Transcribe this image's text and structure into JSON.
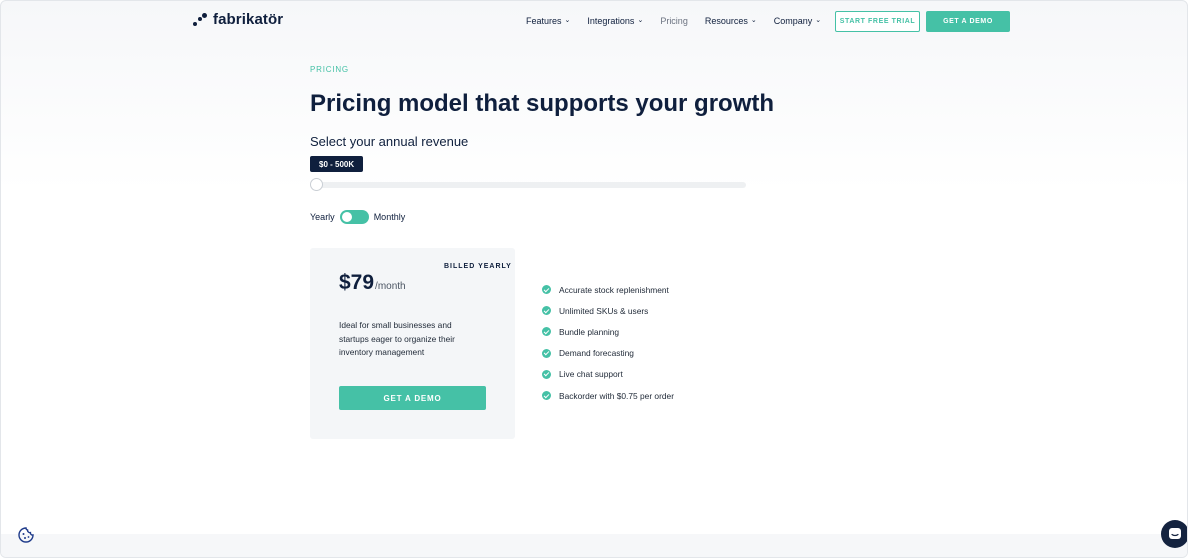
{
  "header": {
    "logo_text": "fabrikatör",
    "nav": [
      {
        "label": "Features",
        "has_dropdown": true
      },
      {
        "label": "Integrations",
        "has_dropdown": true
      },
      {
        "label": "Pricing",
        "has_dropdown": false
      },
      {
        "label": "Resources",
        "has_dropdown": true
      },
      {
        "label": "Company",
        "has_dropdown": true
      }
    ],
    "trial_button": "START FREE TRIAL",
    "demo_button": "GET A DEMO"
  },
  "hero": {
    "eyebrow": "PRICING",
    "title": "Pricing model that supports your growth",
    "revenue_label": "Select your annual revenue",
    "revenue_range": "$0 - 500K",
    "slider_value": 0
  },
  "billing_toggle": {
    "left_label": "Yearly",
    "right_label": "Monthly",
    "selected": "Monthly"
  },
  "plan": {
    "billing_note": "BILLED YEARLY",
    "price": "$79",
    "period": "/month",
    "description": "Ideal for small businesses and startups eager to organize their inventory management",
    "cta": "GET A DEMO"
  },
  "features": [
    "Accurate stock replenishment",
    "Unlimited SKUs & users",
    "Bundle planning",
    "Demand forecasting",
    "Live chat support",
    "Backorder with $0.75 per order"
  ],
  "icons": {
    "feature_check": "check-circle-icon",
    "cookie": "cookie-icon",
    "chat": "chat-icon"
  },
  "colors": {
    "accent": "#45c1a6",
    "navy": "#0f1f3d"
  }
}
